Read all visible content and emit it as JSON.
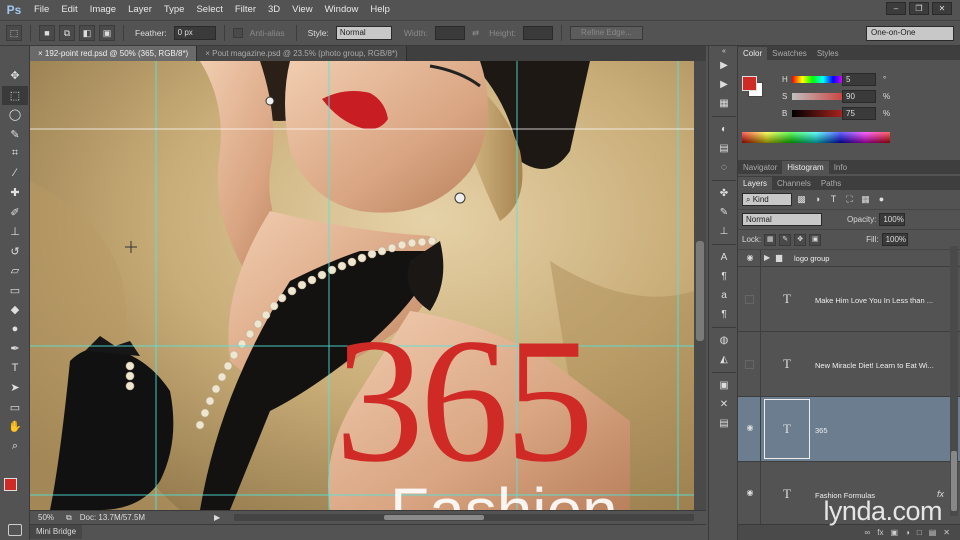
{
  "app": {
    "logo": "Ps",
    "menu": [
      "File",
      "Edit",
      "Image",
      "Layer",
      "Type",
      "Select",
      "Filter",
      "3D",
      "View",
      "Window",
      "Help"
    ],
    "window_controls": [
      "–",
      "❐",
      "✕"
    ]
  },
  "options": {
    "feather_label": "Feather:",
    "feather_value": "0 px",
    "antialias_label": "Anti-alias",
    "style_label": "Style:",
    "style_value": "Normal",
    "width_label": "Width:",
    "height_label": "Height:",
    "refine_edge": "Refine Edge...",
    "workspace": "One-on-One"
  },
  "tabs": [
    {
      "label": "192-point red.psd @ 50% (365, RGB/8*)",
      "close": "×",
      "active": true
    },
    {
      "label": "Pout magazine.psd @ 23.5% (photo group, RGB/8*)",
      "close": "×",
      "active": false
    }
  ],
  "canvas": {
    "big_text": "365",
    "bottom_text": "Fashion",
    "text_color": "#cf2a25"
  },
  "status": {
    "zoom": "50%",
    "doc": "Doc: 13.7M/57.5M"
  },
  "minibridge": "Mini Bridge",
  "color_panel": {
    "tabs": [
      "Color",
      "Swatches",
      "Styles"
    ],
    "sliders": [
      {
        "label": "H",
        "value": "5",
        "unit": "°"
      },
      {
        "label": "S",
        "value": "90",
        "unit": "%"
      },
      {
        "label": "B",
        "value": "75",
        "unit": "%"
      }
    ]
  },
  "nav_panel": {
    "tabs": [
      "Navigator",
      "Histogram",
      "Info"
    ]
  },
  "layers_panel": {
    "tabs": [
      "Layers",
      "Channels",
      "Paths"
    ],
    "kind": "Kind",
    "blend_mode": "Normal",
    "opacity_label": "Opacity:",
    "opacity_value": "100%",
    "lock_label": "Lock:",
    "fill_label": "Fill:",
    "fill_value": "100%",
    "layers": [
      {
        "name": "logo group",
        "type": "group",
        "visible": true,
        "selected": false
      },
      {
        "name": "Make Him Love You In Less than ...",
        "type": "text",
        "visible": false,
        "selected": false
      },
      {
        "name": "New Miracle Diet! Learn to Eat Wi...",
        "type": "text",
        "visible": false,
        "selected": false
      },
      {
        "name": "365",
        "type": "text",
        "visible": true,
        "selected": true
      },
      {
        "name": "Fashion Formulas",
        "type": "text",
        "visible": true,
        "selected": false,
        "fx": "fx"
      }
    ],
    "footer_icons": [
      "∞",
      "fx",
      "▣",
      "◑",
      "□",
      "▤",
      "✕"
    ]
  },
  "watermark": "lynda.com"
}
